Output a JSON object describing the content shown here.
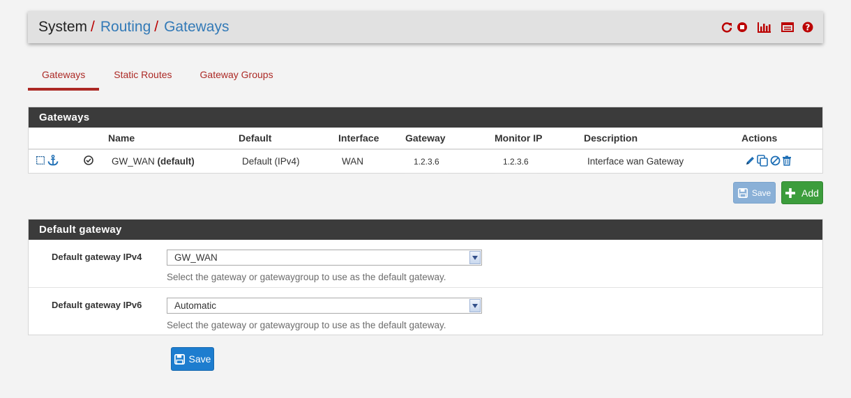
{
  "breadcrumb": {
    "system": "System",
    "sep": "/",
    "routing": "Routing",
    "gateways": "Gateways"
  },
  "header_icons": [
    "reload-icon",
    "stop-icon",
    "bar-chart-icon",
    "log-icon",
    "help-icon"
  ],
  "tabs": [
    {
      "label": "Gateways",
      "active": true
    },
    {
      "label": "Static Routes",
      "active": false
    },
    {
      "label": "Gateway Groups",
      "active": false
    }
  ],
  "gateways_panel": {
    "title": "Gateways",
    "columns": [
      "Name",
      "Default",
      "Interface",
      "Gateway",
      "Monitor IP",
      "Description",
      "Actions"
    ],
    "rows": [
      {
        "name": "GW_WAN",
        "name_suffix": "(default)",
        "default": "Default (IPv4)",
        "interface": "WAN",
        "gateway": "1.2.3.6",
        "monitor_ip": "1.2.3.6",
        "description": "Interface wan Gateway"
      }
    ]
  },
  "buttons": {
    "save_top": "Save",
    "add": "Add",
    "save_bottom": "Save"
  },
  "default_panel": {
    "title": "Default gateway",
    "ipv4_label": "Default gateway IPv4",
    "ipv4_value": "GW_WAN",
    "ipv6_label": "Default gateway IPv6",
    "ipv6_value": "Automatic",
    "help_text": "Select the gateway or gatewaygroup to use as the default gateway."
  },
  "colors": {
    "accent_red": "#ac2925",
    "link_blue": "#337ab7",
    "panel_dark": "#3b3b3b",
    "add_green": "#3c9d3c",
    "save_blue": "#1d7dcf"
  }
}
